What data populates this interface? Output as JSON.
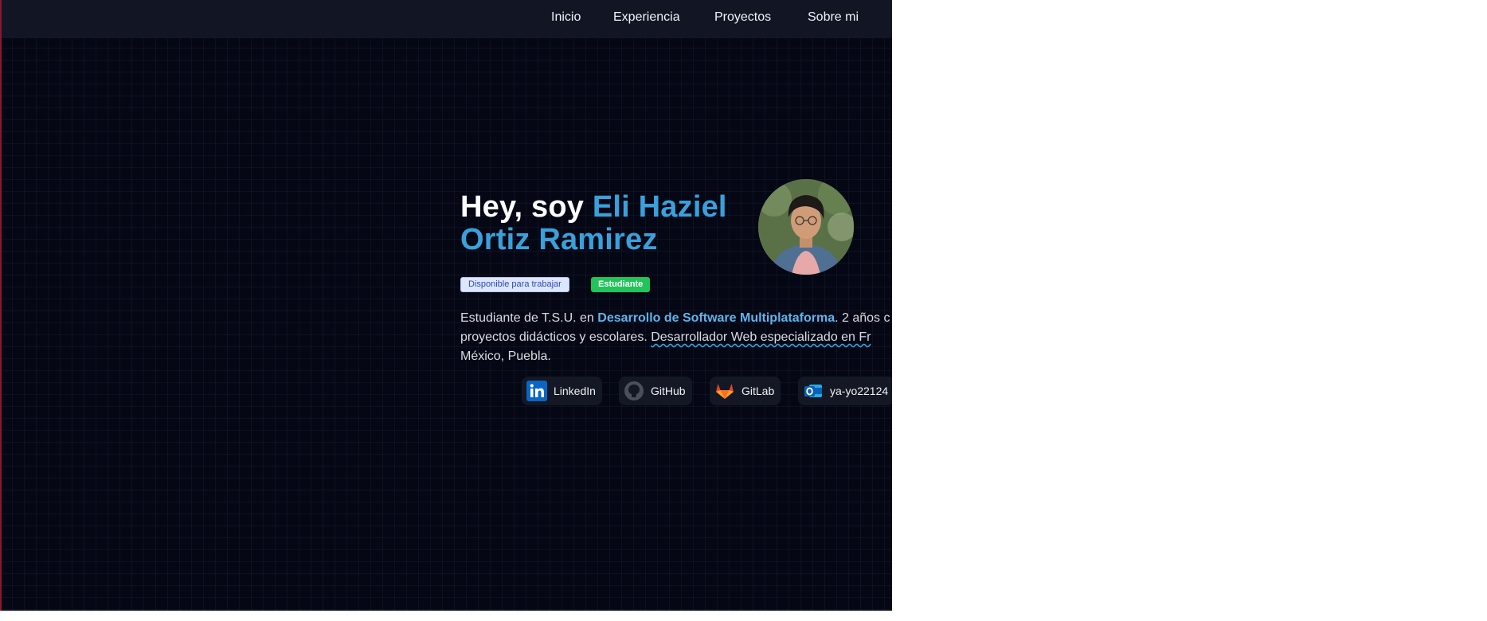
{
  "nav": {
    "items": [
      {
        "label": "Inicio"
      },
      {
        "label": "Experiencia"
      },
      {
        "label": "Proyectos"
      },
      {
        "label": "Sobre mi"
      }
    ]
  },
  "hero": {
    "greeting": "Hey, soy ",
    "name_line1": "Eli Haziel",
    "name_line2": "Ortiz Ramirez",
    "badges": {
      "available": "Disponible para trabajar",
      "student": "Estudiante"
    },
    "bio": {
      "part1": "Estudiante de T.S.U. en ",
      "highlight": "Desarrollo de Software Multiplataforma",
      "part2": ". 2 años c",
      "line2a": "proyectos didácticos y escolares. ",
      "line2b": "Desarrollador Web especializado en Fr",
      "line3": "México, Puebla."
    }
  },
  "social": {
    "linkedin": "LinkedIn",
    "github": "GitHub",
    "gitlab": "GitLab",
    "email": "ya-yo22124"
  },
  "colors": {
    "background": "#050814",
    "nav_background": "#121624",
    "accent": "#3aa0dc",
    "student_badge": "#22c35a"
  }
}
